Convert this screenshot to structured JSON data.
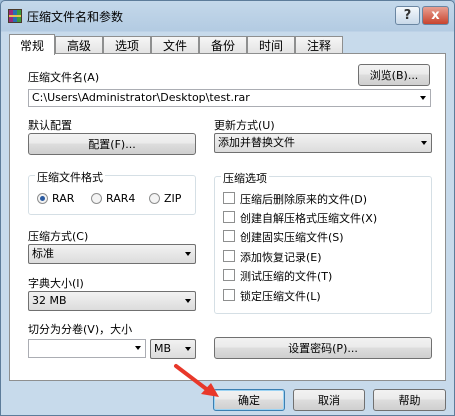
{
  "window": {
    "title": "压缩文件名和参数",
    "help_label": "?",
    "close_label": "x"
  },
  "tabs": [
    {
      "label": "常规"
    },
    {
      "label": "高级"
    },
    {
      "label": "选项"
    },
    {
      "label": "文件"
    },
    {
      "label": "备份"
    },
    {
      "label": "时间"
    },
    {
      "label": "注释"
    }
  ],
  "archive": {
    "name_label": "压缩文件名(A)",
    "browse_label": "浏览(B)...",
    "path_value": "C:\\Users\\Administrator\\Desktop\\test.rar"
  },
  "profile": {
    "label": "默认配置",
    "button_label": "配置(F)..."
  },
  "update_mode": {
    "label": "更新方式(U)",
    "value": "添加并替换文件"
  },
  "format": {
    "title": "压缩文件格式",
    "options": [
      {
        "label": "RAR",
        "checked": true
      },
      {
        "label": "RAR4",
        "checked": false
      },
      {
        "label": "ZIP",
        "checked": false
      }
    ]
  },
  "method": {
    "label": "压缩方式(C)",
    "value": "标准"
  },
  "dictionary": {
    "label": "字典大小(I)",
    "value": "32 MB"
  },
  "split": {
    "label": "切分为分卷(V)，大小",
    "value": "",
    "unit": "MB"
  },
  "options": {
    "title": "压缩选项",
    "items": [
      {
        "label": "压缩后删除原来的文件(D)",
        "checked": false
      },
      {
        "label": "创建自解压格式压缩文件(X)",
        "checked": false
      },
      {
        "label": "创建固实压缩文件(S)",
        "checked": false
      },
      {
        "label": "添加恢复记录(E)",
        "checked": false
      },
      {
        "label": "测试压缩的文件(T)",
        "checked": false
      },
      {
        "label": "锁定压缩文件(L)",
        "checked": false
      }
    ]
  },
  "password_label": "设置密码(P)...",
  "footer": {
    "ok": "确定",
    "cancel": "取消",
    "help": "帮助"
  },
  "colors": {
    "annotation_arrow": "#e8382a"
  }
}
